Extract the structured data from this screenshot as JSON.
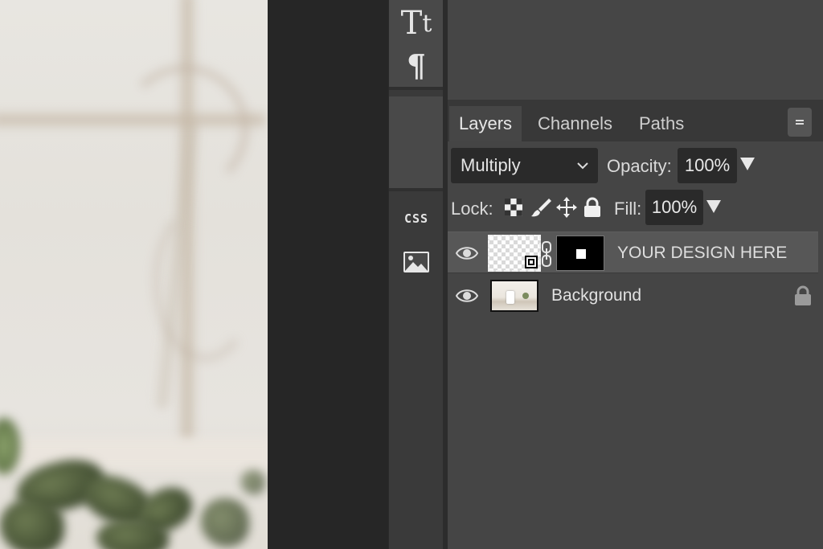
{
  "tools": {
    "type_tool_glyph_big": "T",
    "type_tool_glyph_small": "t",
    "paragraph_glyph": "¶",
    "css_label": "CSS",
    "image_icon": "image-icon"
  },
  "panel": {
    "tabs": [
      {
        "label": "Layers",
        "active": true
      },
      {
        "label": "Channels",
        "active": false
      },
      {
        "label": "Paths",
        "active": false
      }
    ],
    "menu_icon": "panel-menu-icon",
    "blend_mode": "Multiply",
    "opacity_label": "Opacity:",
    "opacity_value": "100%",
    "lock_label": "Lock:",
    "lock_icons": [
      "transparency-lock-icon",
      "brush-lock-icon",
      "move-lock-icon",
      "padlock-icon"
    ],
    "fill_label": "Fill:",
    "fill_value": "100%"
  },
  "layers": [
    {
      "name": "YOUR DESIGN HERE",
      "visible": true,
      "selected": true,
      "type": "smart-object-with-mask"
    },
    {
      "name": "Background",
      "visible": true,
      "selected": false,
      "locked": true,
      "type": "image"
    }
  ],
  "colors": {
    "panel_bg": "#454545",
    "field_bg": "#2a2a2a",
    "selected_row": "#575757",
    "text": "#e2e2e2"
  }
}
